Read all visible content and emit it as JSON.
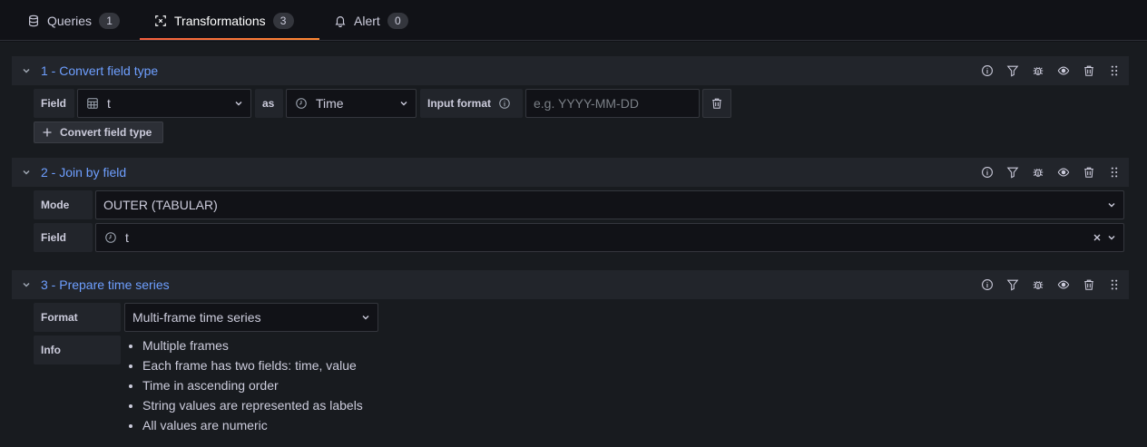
{
  "tabs": [
    {
      "label": "Queries",
      "count": "1",
      "icon": "database-icon"
    },
    {
      "label": "Transformations",
      "count": "3",
      "icon": "transform-icon"
    },
    {
      "label": "Alert",
      "count": "0",
      "icon": "bell-icon"
    }
  ],
  "transformations": [
    {
      "title": "1 - Convert field type",
      "field_label": "Field",
      "field_value": "t",
      "as_label": "as",
      "type_value": "Time",
      "input_format_label": "Input format",
      "input_format_placeholder": "e.g. YYYY-MM-DD",
      "add_button_label": "Convert field type"
    },
    {
      "title": "2 - Join by field",
      "mode_label": "Mode",
      "mode_value": "OUTER (TABULAR)",
      "field_label": "Field",
      "field_value": "t"
    },
    {
      "title": "3 - Prepare time series",
      "format_label": "Format",
      "format_value": "Multi-frame time series",
      "info_label": "Info",
      "info_items": [
        "Multiple frames",
        "Each frame has two fields: time, value",
        "Time in ascending order",
        "String values are represented as labels",
        "All values are numeric"
      ]
    }
  ],
  "colors": {
    "accent_title": "#6e9fff",
    "tab_underline": "#f55f3e",
    "background": "#111217",
    "panel": "#181b1f",
    "header": "#22252b"
  }
}
